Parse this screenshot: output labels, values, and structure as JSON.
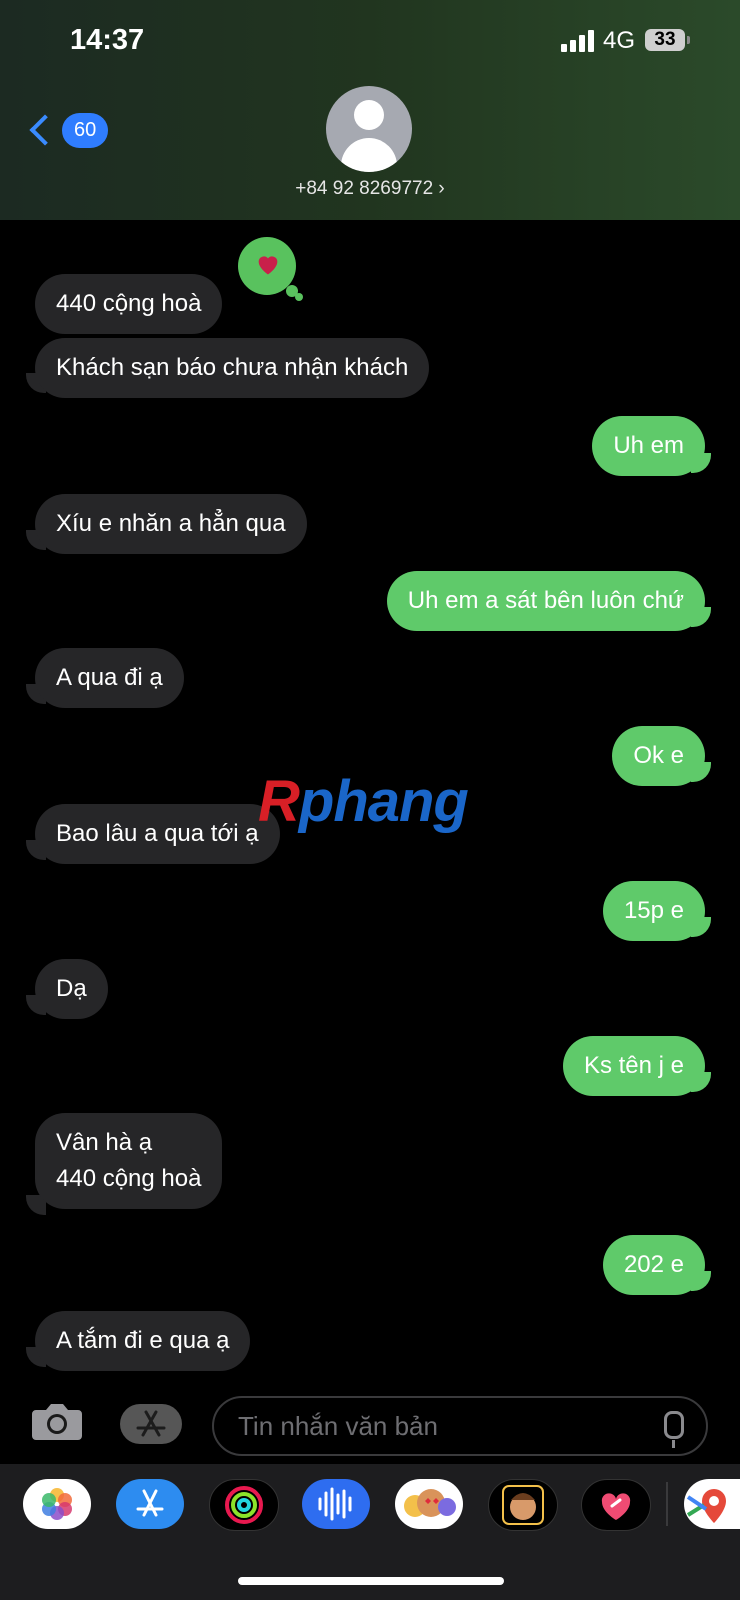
{
  "status_bar": {
    "time": "14:37",
    "network": "4G",
    "battery": "33"
  },
  "nav": {
    "back_count": "60",
    "contact": "+84 92 8269772 ›"
  },
  "messages": [
    {
      "dir": "in",
      "text": "440 cộng hoà"
    },
    {
      "dir": "in",
      "text": "Khách sạn báo chưa nhận khách"
    },
    {
      "dir": "out",
      "text": "Uh em"
    },
    {
      "dir": "in",
      "text": "Xíu e nhăn a hẳn qua"
    },
    {
      "dir": "out",
      "text": "Uh em a sát bên luôn chứ"
    },
    {
      "dir": "in",
      "text": "A qua đi ạ"
    },
    {
      "dir": "out",
      "text": "Ok e"
    },
    {
      "dir": "in",
      "text": "Bao lâu a qua tới ạ"
    },
    {
      "dir": "out",
      "text": "15p e"
    },
    {
      "dir": "in",
      "text": "Dạ"
    },
    {
      "dir": "out",
      "text": "Ks tên j e"
    },
    {
      "dir": "in",
      "text": "Vân hà ạ\n440 cộng hoà"
    },
    {
      "dir": "out",
      "text": "202 e"
    },
    {
      "dir": "in",
      "text": "A tắm đi e qua ạ"
    }
  ],
  "watermark": {
    "first": "R",
    "rest": "phang"
  },
  "composer": {
    "placeholder": "Tin nhắn văn bản"
  },
  "colors": {
    "incoming": "#262628",
    "outgoing": "#5fca6a",
    "accent": "#2f7dff"
  },
  "tray_icons": [
    "photos-icon",
    "app-store-icon",
    "activity-icon",
    "voice-memo-icon",
    "memoji-stickers-icon",
    "memoji-icon",
    "digital-touch-icon",
    "maps-icon"
  ]
}
